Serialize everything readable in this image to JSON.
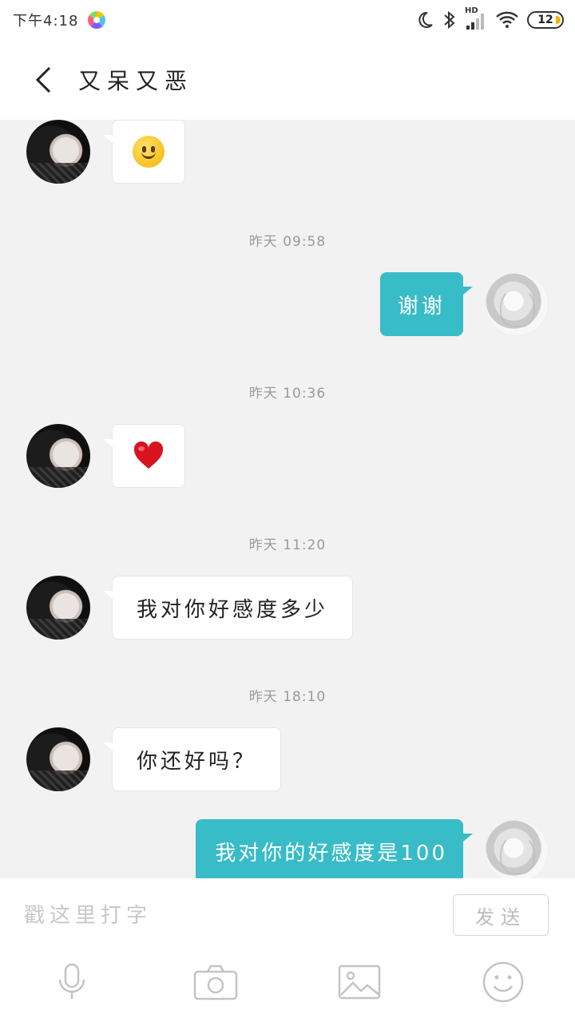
{
  "status_bar": {
    "time": "下午4:18",
    "battery": "12",
    "network_badge": "HD",
    "icons": [
      "app-icon",
      "moon-icon",
      "bluetooth-icon",
      "signal-icon",
      "wifi-icon",
      "battery-icon"
    ]
  },
  "header": {
    "title": "又呆又恶",
    "back_icon": "chevron-left-icon"
  },
  "messages": [
    {
      "side": "in",
      "type": "emoji",
      "emoji": "smile-emoji"
    },
    {
      "type": "timestamp",
      "text": "昨天  09:58"
    },
    {
      "side": "out",
      "type": "text",
      "text": "谢谢"
    },
    {
      "type": "timestamp",
      "text": "昨天  10:36"
    },
    {
      "side": "in",
      "type": "emoji",
      "emoji": "heart-emoji"
    },
    {
      "type": "timestamp",
      "text": "昨天  11:20"
    },
    {
      "side": "in",
      "type": "text",
      "text": "我对你好感度多少"
    },
    {
      "type": "timestamp",
      "text": "昨天  18:10"
    },
    {
      "side": "in",
      "type": "text",
      "text": "你还好吗？"
    },
    {
      "side": "out",
      "type": "text",
      "text": "我对你的好感度是100"
    }
  ],
  "colors": {
    "accent": "#38bcc7",
    "background": "#f2f2f2",
    "timestamp": "#9a9a9a"
  },
  "input_bar": {
    "placeholder": "戳这里打字",
    "send_label": "发送",
    "tools": [
      "microphone-icon",
      "camera-icon",
      "image-icon",
      "emoji-icon"
    ]
  }
}
